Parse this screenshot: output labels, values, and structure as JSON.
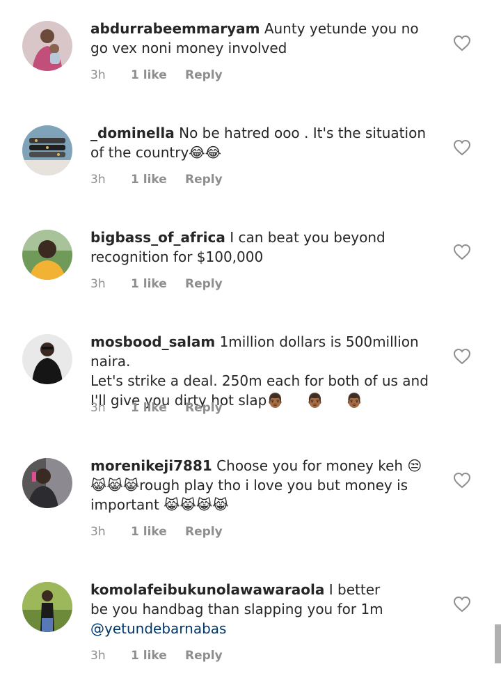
{
  "comments": [
    {
      "username": "abdurrabeemmaryam",
      "text": "Aunty yetunde you no go vex noni money involved",
      "time": "3h",
      "likes": "1 like",
      "reply": "Reply"
    },
    {
      "username": "_dominella",
      "text": "No be hatred ooo . It's the situation of the country😂😂",
      "time": "3h",
      "likes": "1 like",
      "reply": "Reply"
    },
    {
      "username": "bigbass_of_africa",
      "text": "I can beat you beyond recognition for $100,000",
      "time": "3h",
      "likes": "1 like",
      "reply": "Reply"
    },
    {
      "username": "mosbood_salam",
      "text_line1": "1million dollars is 500million naira.",
      "text_line2": "Let's strike a deal. 250m each for both of us and",
      "text_line3": "I'll give you dirty hot slap👨🏾     👨🏾     👨🏾",
      "time": "3h",
      "likes": "1 like",
      "reply": "Reply"
    },
    {
      "username": "morenikeji7881",
      "text_line1": "Choose you for money keh 😒",
      "text_line2": "😹😹😹rough play tho i love you but money is",
      "text_line3": "important 😹😹😹😹",
      "time": "3h",
      "likes": "1 like",
      "reply": "Reply"
    },
    {
      "username": "komolafeibukunolawawaraola",
      "text_line1": "I better",
      "text_line2": "be you handbag than slapping you for 1m",
      "mention": "@yetundebarnabas",
      "time": "3h",
      "likes": "1 like",
      "reply": "Reply"
    }
  ],
  "icons": {
    "like": "heart-outline-icon"
  },
  "colors": {
    "text": "#262626",
    "meta": "#8e8e8e",
    "mention": "#00376b"
  }
}
